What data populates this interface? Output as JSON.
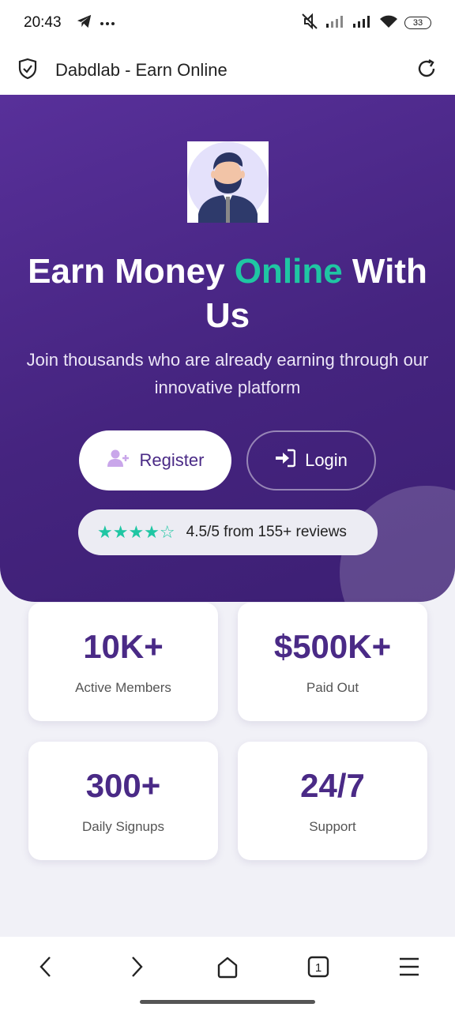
{
  "status_bar": {
    "time": "20:43",
    "battery": "33",
    "icons": [
      "telegram-icon",
      "more-dots-icon",
      "mute-icon",
      "signal-icon",
      "signal-icon",
      "wifi-icon",
      "battery-icon"
    ]
  },
  "browser": {
    "title": "Dabdlab - Earn Online",
    "icons": [
      "shield-check-icon",
      "reload-icon"
    ]
  },
  "hero": {
    "title_part1": "Earn Money ",
    "title_accent": "Online",
    "title_part2": " With Us",
    "subtitle": "Join thousands who are already earning through our innovative platform",
    "register_label": "Register",
    "login_label": "Login",
    "stars": "★★★★☆",
    "reviews_text": "4.5/5 from 155+ reviews",
    "accent_color": "#1fc6a3",
    "brand_color": "#4a2a86"
  },
  "stats": [
    {
      "value": "10K+",
      "label": "Active Members"
    },
    {
      "value": "$500K+",
      "label": "Paid Out"
    },
    {
      "value": "300+",
      "label": "Daily Signups"
    },
    {
      "value": "24/7",
      "label": "Support"
    }
  ],
  "bottom_nav": {
    "tab_count": "1",
    "items": [
      "back-icon",
      "forward-icon",
      "home-icon",
      "tabs-icon",
      "menu-icon"
    ]
  }
}
